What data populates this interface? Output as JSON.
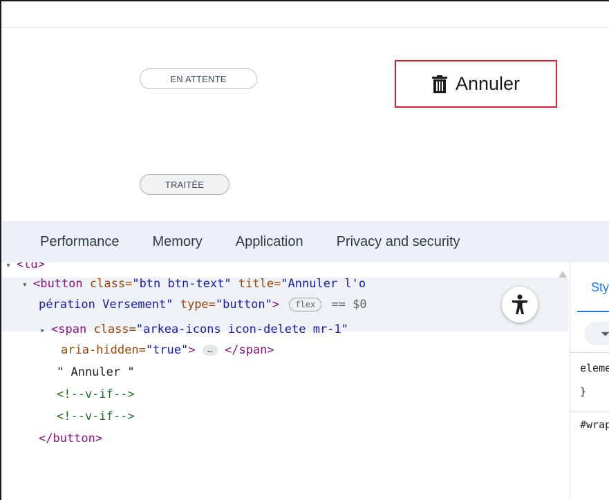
{
  "page": {
    "status_pending": "EN ATTENTE",
    "status_done": "TRAITÉE",
    "cancel_button": "Annuler"
  },
  "devtools": {
    "tabs": [
      "Performance",
      "Memory",
      "Application",
      "Privacy and security"
    ],
    "elements": {
      "parent_tag": "<td>",
      "button_open": "<button",
      "class_attr": "class=",
      "class_val": "\"btn btn-text\"",
      "title_attr": "title=",
      "title_val_1": "\"Annuler l'o",
      "title_val_2": "pération Versement\"",
      "type_attr": "type=",
      "type_val": "\"button\"",
      "gt": ">",
      "flex_pill": "flex",
      "dollar0": "== $0",
      "span_open": "<span",
      "span_class_val": "\"arkea-icons icon-delete mr-1\"",
      "aria_attr": "aria-hidden=",
      "aria_val": "\"true\"",
      "ellipsis": "…",
      "span_close": "</span>",
      "text_node": "\" Annuler \"",
      "comment_1": "<!--v-if-->",
      "comment_2": "<!--v-if-->",
      "button_close": "</button>"
    },
    "styles": {
      "tab_label": "Styles",
      "line_1": "element.style {",
      "line_2": "}",
      "line_3": "#wrapper"
    }
  },
  "colors": {
    "cancel_border": "#d4202e",
    "tabs_bg": "#ecf1f8",
    "selected_row_bg": "#eef1f6"
  }
}
